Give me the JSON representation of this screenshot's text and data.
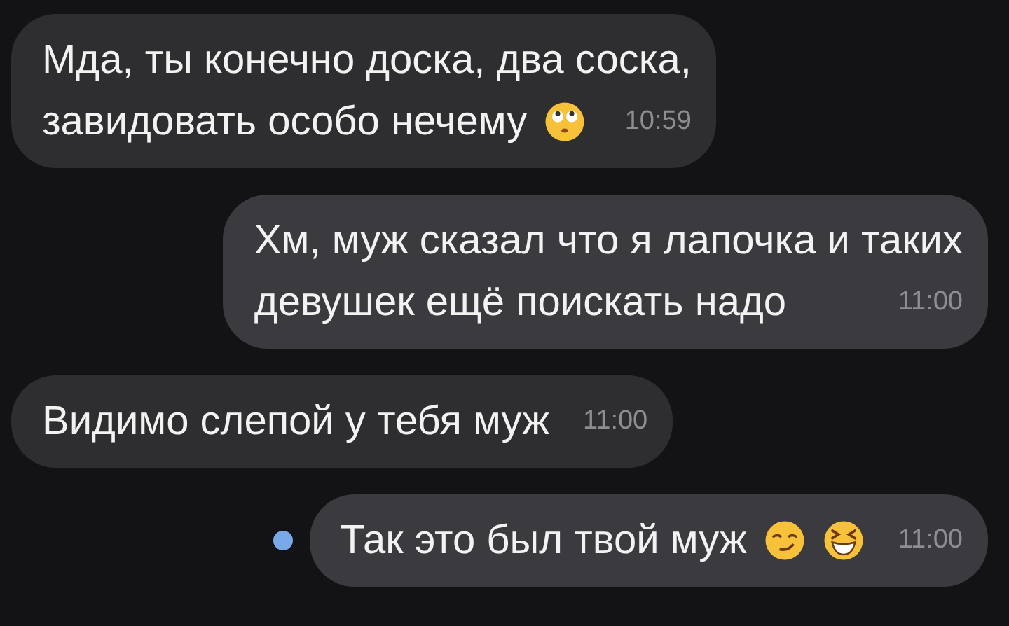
{
  "messages": [
    {
      "kind": "incoming",
      "lines": [
        "Мда, ты конечно доска, два соска,",
        "завидовать особо нечему"
      ],
      "icons": [
        {
          "kind": "eye-roll"
        }
      ],
      "time": "10:59",
      "unread": false
    },
    {
      "kind": "outgoing",
      "lines": [
        "Хм, муж сказал что я лапочка и таких",
        "девушек ещё поискать надо"
      ],
      "time": "11:00",
      "unread": false
    },
    {
      "kind": "incoming",
      "lines": [
        "Видимо слепой у тебя муж"
      ],
      "time": "11:00",
      "unread": false
    },
    {
      "kind": "outgoing",
      "lines": [
        "Так это был твой муж"
      ],
      "icons": [
        {
          "kind": "smirk"
        },
        {
          "kind": "laugh"
        }
      ],
      "time": "11:00",
      "unread": true
    }
  ]
}
